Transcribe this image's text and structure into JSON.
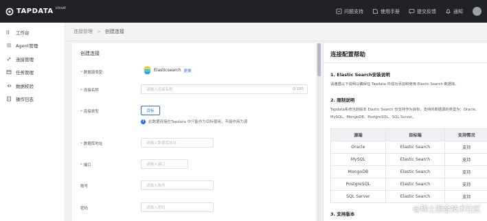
{
  "app": {
    "logo_text": "TAPDATA",
    "logo_cloud": "cloud",
    "accent": "#2c65ff"
  },
  "topbar": {
    "actions": [
      {
        "label": "问题支持",
        "icon": "support-icon"
      },
      {
        "label": "使用手册",
        "icon": "manual-icon"
      },
      {
        "label": "提交反馈",
        "icon": "feedback-icon"
      },
      {
        "label": "通知",
        "icon": "bell-icon"
      }
    ]
  },
  "sidebar": {
    "items": [
      {
        "label": "工作台",
        "icon": "workbench-icon"
      },
      {
        "label": "Agent管理",
        "icon": "agent-icon"
      },
      {
        "label": "连接管理",
        "icon": "connection-icon"
      },
      {
        "label": "任务管理",
        "icon": "task-icon"
      },
      {
        "label": "数据校验",
        "icon": "verify-icon"
      },
      {
        "label": "操作日志",
        "icon": "log-icon"
      }
    ]
  },
  "breadcrumb": {
    "parent": "连接管理",
    "separator": ">",
    "current": "创建连接"
  },
  "form": {
    "title": "创建连接",
    "db_type_label": "数据源类型:",
    "db_type_value": "Elasticsearch",
    "db_type_change": "更换",
    "name_label": "连接名称",
    "name_placeholder": "请输入连接名称",
    "name_count": "0/100",
    "conn_type_label": "连接类型",
    "conn_type_value": "目标",
    "conn_type_hint": "此数据连接在Tapdata 中只能作为目标使用，不能作用为源",
    "host_label": "数据库地址",
    "host_placeholder": "请输入数据库地址",
    "port_label": "端口",
    "port_placeholder": "请输入端口",
    "user_label": "账号",
    "user_placeholder": "请输入账号",
    "pwd_label": "密码",
    "pwd_placeholder": "请输入密码"
  },
  "help": {
    "title": "连接配置帮助",
    "sec1_title": "1. Elastic Search安装说明",
    "sec1_text": "请遵循以下说明以确保在 Tapdata 中成功添加和使用 Elastic Search 数据库。",
    "sec2_title": "2. 限制说明",
    "sec2_text_line1": "Tapdata系统当前版本 Elastic Search 仅支持作为目标，支持的数据源的类型为：Oracle、",
    "sec2_text_line2": "MySQL、MongoDB、PostgreSQL、SQL Server。",
    "table": {
      "headers": [
        "源端",
        "目标端",
        "支持情况"
      ],
      "rows": [
        [
          "Oracle",
          "Elastic Search",
          "支持"
        ],
        [
          "MySQL",
          "Elastic Search",
          "支持"
        ],
        [
          "MongoDB",
          "Elastic Search",
          "支持"
        ],
        [
          "PostgreSQL",
          "Elastic Search",
          "支持"
        ],
        [
          "SQL Server",
          "Elastic Search",
          "支持"
        ]
      ]
    },
    "sec3_title": "3. 支持版本"
  },
  "watermark": "@稀土掘金技术社区"
}
